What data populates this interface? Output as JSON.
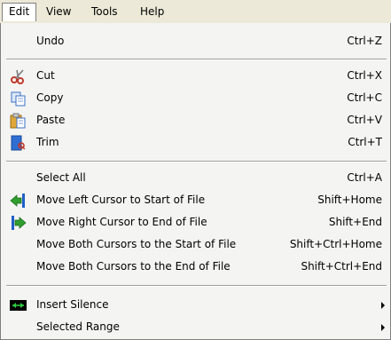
{
  "menubar": {
    "items": [
      {
        "label": "Edit"
      },
      {
        "label": "View"
      },
      {
        "label": "Tools"
      },
      {
        "label": "Help"
      }
    ]
  },
  "edit_menu": {
    "undo": {
      "label": "Undo",
      "shortcut": "Ctrl+Z"
    },
    "cut": {
      "label": "Cut",
      "shortcut": "Ctrl+X",
      "icon": "scissors-icon"
    },
    "copy": {
      "label": "Copy",
      "shortcut": "Ctrl+C",
      "icon": "copy-icon"
    },
    "paste": {
      "label": "Paste",
      "shortcut": "Ctrl+V",
      "icon": "paste-icon"
    },
    "trim": {
      "label": "Trim",
      "shortcut": "Ctrl+T",
      "icon": "trim-icon"
    },
    "select_all": {
      "label": "Select All",
      "shortcut": "Ctrl+A"
    },
    "move_left": {
      "label": "Move Left Cursor to Start of File",
      "shortcut": "Shift+Home",
      "icon": "left-cursor-arrow-icon"
    },
    "move_right": {
      "label": "Move Right Cursor to End of File",
      "shortcut": "Shift+End",
      "icon": "right-cursor-arrow-icon"
    },
    "move_both_start": {
      "label": "Move Both Cursors to the Start of File",
      "shortcut": "Shift+Ctrl+Home"
    },
    "move_both_end": {
      "label": "Move Both Cursors to the End of File",
      "shortcut": "Shift+Ctrl+End"
    },
    "insert_silence": {
      "label": "Insert Silence",
      "icon": "insert-silence-icon"
    },
    "selected_range": {
      "label": "Selected Range"
    }
  },
  "colors": {
    "menu_background": "#f4f4f3",
    "menubar_background": "#ece9d8",
    "icon_green": "#2e9e2e",
    "icon_blue": "#1f5fc8"
  }
}
